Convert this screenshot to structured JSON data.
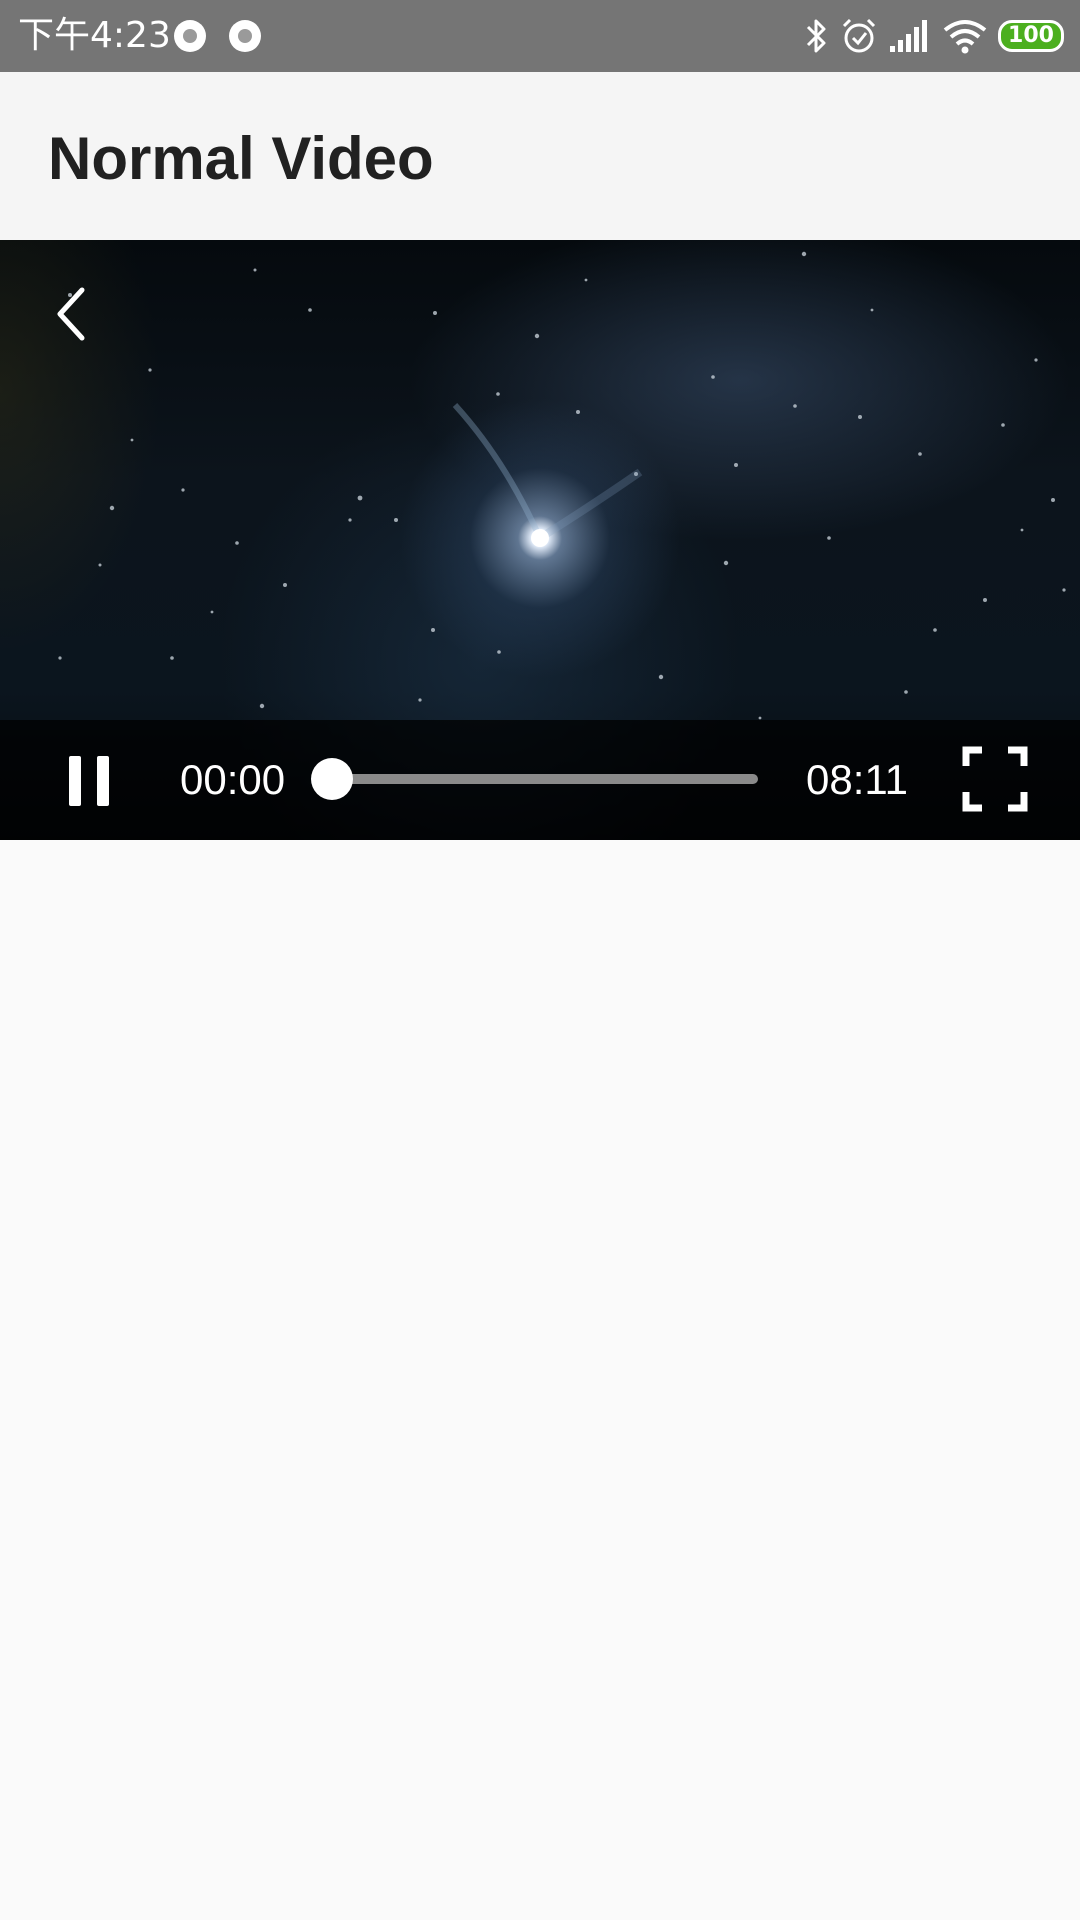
{
  "status_bar": {
    "time": "下午4:23",
    "battery_level": "100",
    "icons": [
      "notification-dot-icon",
      "notification-dot-icon",
      "bluetooth-icon",
      "alarm-icon",
      "signal-icon",
      "wifi-icon",
      "battery-icon"
    ],
    "battery_color": "#4caf1f"
  },
  "app_bar": {
    "title": "Normal Video"
  },
  "player": {
    "back_icon": "chevron-left-icon",
    "play_state_icon": "pause-icon",
    "current_time": "00:00",
    "total_time": "08:11",
    "progress_fraction": 0.0,
    "fullscreen_icon": "fullscreen-icon"
  },
  "colors": {
    "status_bar_bg": "#757575",
    "app_bar_bg": "#f5f5f5",
    "page_bg": "#fafafa",
    "title_text": "#212121",
    "seek_track": "#8a8a8a"
  }
}
